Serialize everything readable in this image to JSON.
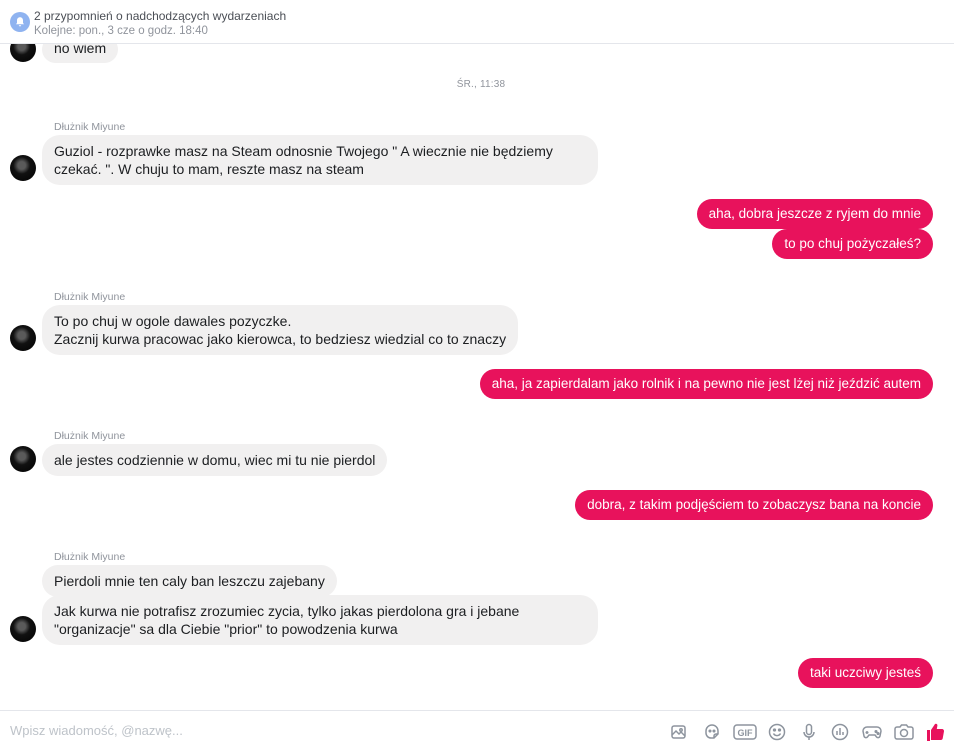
{
  "reminder": {
    "title": "2 przypomnień o nadchodzących wydarzeniach",
    "subtitle": "Kolejne: pon., 3 cze o godz. 18:40"
  },
  "timestamp": "ŚR., 11:38",
  "messages": [
    {
      "direction": "in",
      "text": "no wiem"
    },
    {
      "direction": "in",
      "sender": "Dłużnik Miyune",
      "lines": [
        "Guziol - rozprawke masz na Steam odnosnie Twojego \" A wiecznie nie będziemy",
        "czekać. \". W chuju to mam, reszte masz na steam"
      ]
    },
    {
      "direction": "out",
      "text": "aha, dobra jeszcze z ryjem do mnie"
    },
    {
      "direction": "out",
      "text": "to po chuj pożyczałeś?"
    },
    {
      "direction": "in",
      "sender": "Dłużnik Miyune",
      "lines": [
        "To po chuj w ogole dawales pozyczke.",
        "Zacznij kurwa pracowac jako kierowca, to bedziesz wiedzial co to znaczy"
      ]
    },
    {
      "direction": "out",
      "text": "aha, ja zapierdalam jako rolnik i na pewno nie jest lżej niż jeździć autem"
    },
    {
      "direction": "in",
      "sender": "Dłużnik Miyune",
      "text": "ale jestes codziennie w domu, wiec mi tu nie pierdol"
    },
    {
      "direction": "out",
      "text": "dobra, z takim podjęściem to zobaczysz bana na koncie"
    },
    {
      "direction": "in",
      "sender": "Dłużnik Miyune",
      "text": "Pierdoli mnie ten caly ban leszczu zajebany"
    },
    {
      "direction": "in",
      "lines": [
        "Jak kurwa nie potrafisz zrozumiec zycia, tylko jakas pierdolona gra i jebane",
        "\"organizacje\" sa dla Ciebie \"prior\" to powodzenia kurwa"
      ]
    },
    {
      "direction": "out",
      "text": "taki uczciwy jesteś"
    }
  ],
  "composer": {
    "placeholder": "Wpisz wiadomość, @nazwę...",
    "tools": [
      "sticker-image-icon",
      "emoji-sticker-icon",
      "gif-icon",
      "emoji-icon",
      "microphone-icon",
      "poll-icon",
      "game-controller-icon",
      "camera-icon",
      "thumbs-up-icon"
    ],
    "gif_label": "GIF",
    "accent": "#e8125c",
    "incoming_bubble": "#f1f0f0"
  }
}
